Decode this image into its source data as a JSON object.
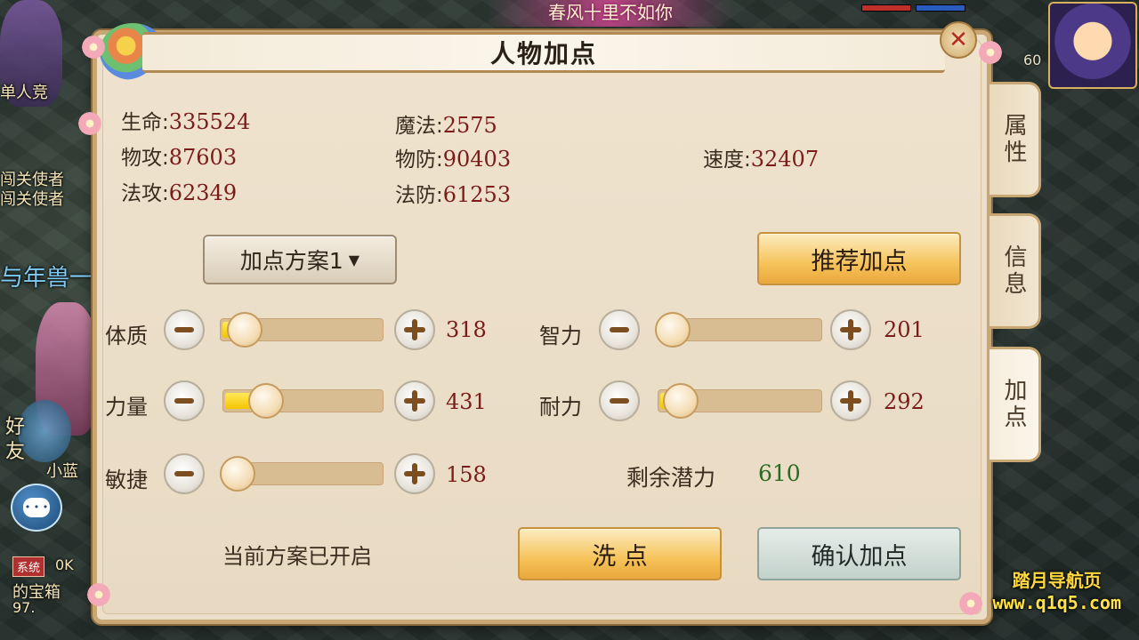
{
  "background": {
    "banner": "春风十里不如你",
    "left_texts": [
      "单人竞",
      "闯关使者",
      "闯关使者",
      "与年兽一",
      "好",
      "友",
      "小蓝",
      "的宝箱",
      "97.",
      "0K"
    ],
    "sys_tag": "系统",
    "level": "60"
  },
  "watermark": {
    "line1": "踏月导航页",
    "line2": "www.q1q5.com"
  },
  "window": {
    "title": "人物加点",
    "close_icon": "✕"
  },
  "tabs": [
    "属性",
    "信息",
    "加点"
  ],
  "stats": {
    "hp": {
      "label": "生命:",
      "value": "335524"
    },
    "mp": {
      "label": "魔法:",
      "value": "2575"
    },
    "patk": {
      "label": "物攻:",
      "value": "87603"
    },
    "pdef": {
      "label": "物防:",
      "value": "90403"
    },
    "speed": {
      "label": "速度:",
      "value": "32407"
    },
    "matk": {
      "label": "法攻:",
      "value": "62349"
    },
    "mdef": {
      "label": "法防:",
      "value": "61253"
    }
  },
  "plan_dropdown": {
    "label": "加点方案1",
    "arrow": "▼"
  },
  "recommend_button": "推荐加点",
  "attributes": [
    {
      "key": "tizhi",
      "label": "体质",
      "value": "318",
      "fill": 0.13,
      "green": 0.0
    },
    {
      "key": "liliang",
      "label": "力量",
      "value": "431",
      "fill": 0.25,
      "green": 0.07
    },
    {
      "key": "minjie",
      "label": "敏捷",
      "value": "158",
      "fill": 0.05,
      "green": 0.0
    },
    {
      "key": "zhili",
      "label": "智力",
      "value": "201",
      "fill": 0.06,
      "green": 0.0
    },
    {
      "key": "naili",
      "label": "耐力",
      "value": "292",
      "fill": 0.12,
      "green": 0.0
    }
  ],
  "potential": {
    "label": "剩余潜力",
    "value": "610"
  },
  "status_text": "当前方案已开启",
  "wash_button": "洗 点",
  "confirm_button": "确认加点"
}
